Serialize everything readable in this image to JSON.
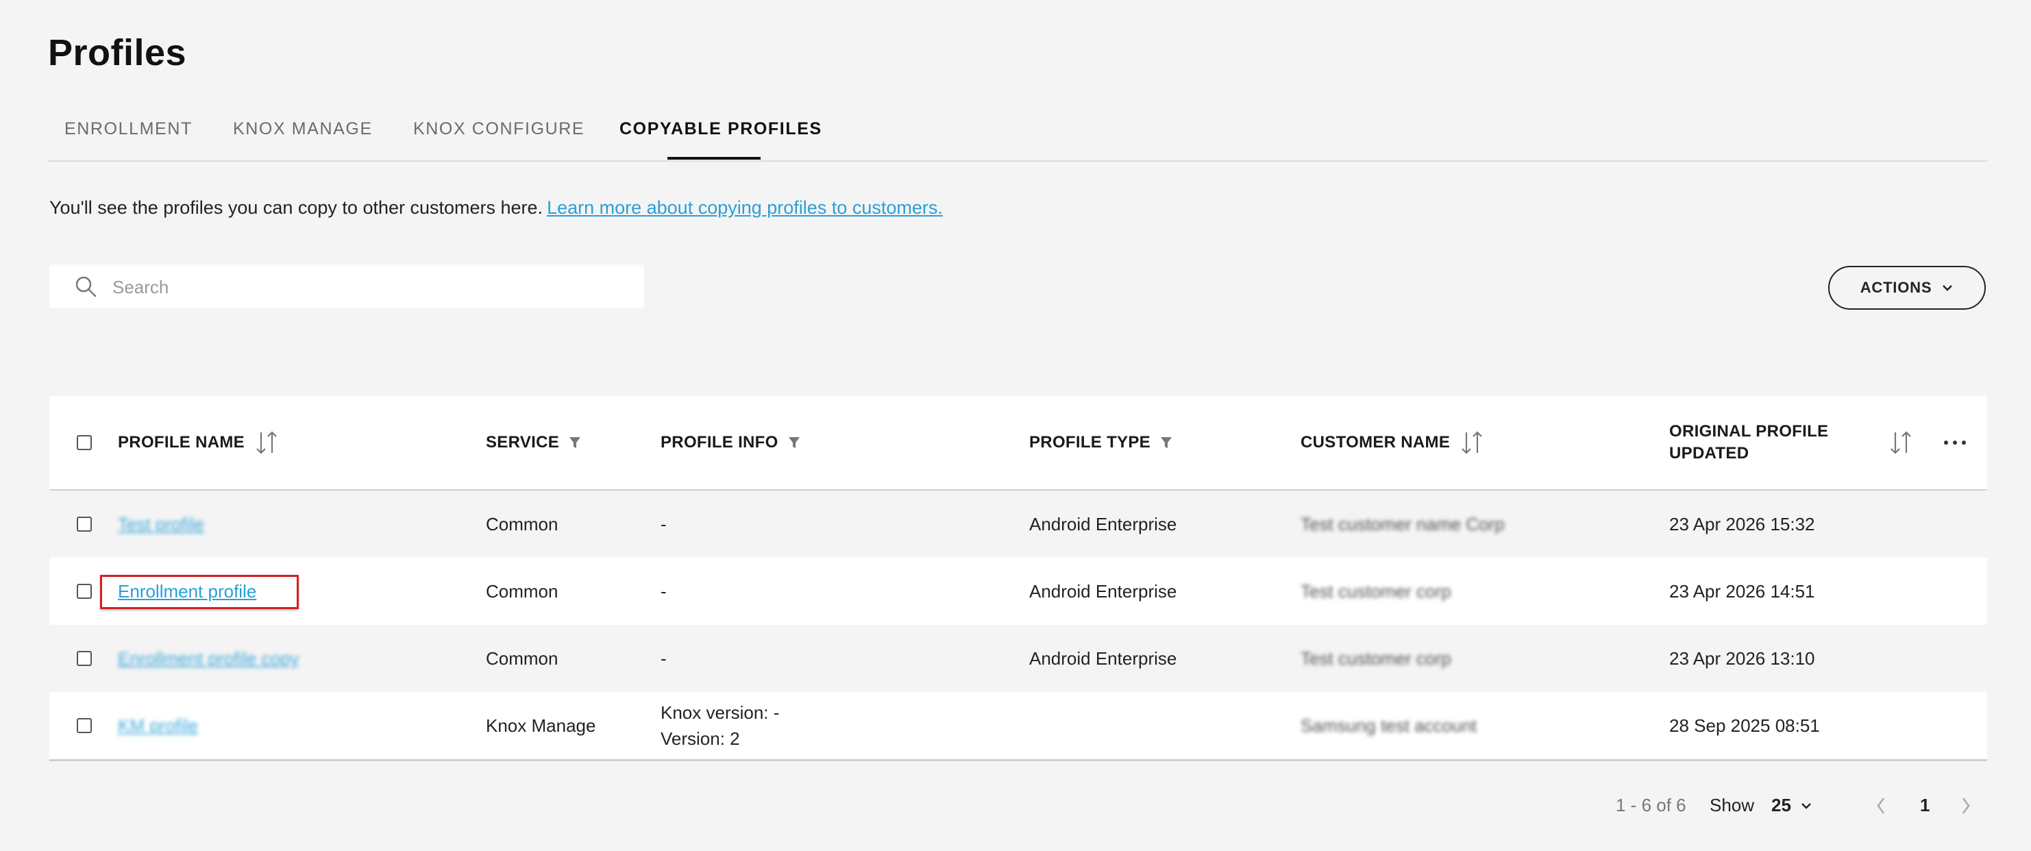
{
  "page": {
    "title": "Profiles"
  },
  "tabs": [
    {
      "label": "ENROLLMENT"
    },
    {
      "label": "KNOX MANAGE"
    },
    {
      "label": "KNOX CONFIGURE"
    },
    {
      "label": "COPYABLE PROFILES",
      "active": true
    }
  ],
  "intro": {
    "text": "You'll see the profiles you can copy to other customers here.",
    "link_text": "Learn more about copying profiles to customers."
  },
  "search": {
    "placeholder": "Search"
  },
  "actions": {
    "label": "ACTIONS"
  },
  "table": {
    "headers": {
      "profile_name": "PROFILE NAME",
      "service": "SERVICE",
      "profile_info": "PROFILE INFO",
      "profile_type": "PROFILE TYPE",
      "customer_name": "CUSTOMER NAME",
      "original_updated_line1": "ORIGINAL PROFILE",
      "original_updated_line2": "UPDATED"
    },
    "rows": [
      {
        "profile_name": "Test profile",
        "service": "Common",
        "info_line1": "-",
        "info_line2": "",
        "profile_type": "Android Enterprise",
        "customer_name": "Test customer name Corp",
        "updated": "23 Apr 2026 15:32"
      },
      {
        "profile_name": "Enrollment profile",
        "service": "Common",
        "info_line1": "-",
        "info_line2": "",
        "profile_type": "Android Enterprise",
        "customer_name": "Test customer corp",
        "updated": "23 Apr 2026 14:51"
      },
      {
        "profile_name": "Enrollment profile copy",
        "service": "Common",
        "info_line1": "-",
        "info_line2": "",
        "profile_type": "Android Enterprise",
        "customer_name": "Test customer corp",
        "updated": "23 Apr 2026 13:10"
      },
      {
        "profile_name": "KM profile",
        "service": "Knox Manage",
        "info_line1": "Knox version: -",
        "info_line2": "Version: 2",
        "profile_type": "",
        "customer_name": "Samsung test account",
        "updated": "28 Sep 2025 08:51"
      }
    ]
  },
  "pagination": {
    "range": "1 - 6 of 6",
    "show_label": "Show",
    "page_size": "25",
    "current_page": "1"
  }
}
